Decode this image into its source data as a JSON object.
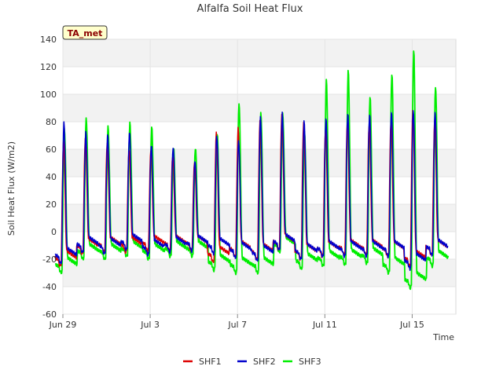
{
  "chart_data": {
    "type": "line",
    "title": "Alfalfa Soil Heat Flux",
    "xlabel": "Time",
    "ylabel": "Soil Heat Flux (W/m2)",
    "badge": "TA_met",
    "xlim": [
      "2023-06-29",
      "2023-07-17"
    ],
    "ylim": [
      -60,
      140
    ],
    "yticks": [
      -60,
      -40,
      -20,
      0,
      20,
      40,
      60,
      80,
      100,
      120,
      140
    ],
    "xticks": [
      {
        "date": "2023-06-29",
        "label": "Jun 29"
      },
      {
        "date": "2023-07-03",
        "label": "Jul 3"
      },
      {
        "date": "2023-07-07",
        "label": "Jul 7"
      },
      {
        "date": "2023-07-11",
        "label": "Jul 11"
      },
      {
        "date": "2023-07-15",
        "label": "Jul 15"
      }
    ],
    "legend_position": "bottom",
    "grid": true,
    "x": [
      "2023-06-29",
      "2023-06-30",
      "2023-07-01",
      "2023-07-02",
      "2023-07-03",
      "2023-07-04",
      "2023-07-05",
      "2023-07-06",
      "2023-07-07",
      "2023-07-08",
      "2023-07-09",
      "2023-07-10",
      "2023-07-11",
      "2023-07-12",
      "2023-07-13",
      "2023-07-14",
      "2023-07-15",
      "2023-07-16"
    ],
    "series": [
      {
        "name": "SHF1",
        "color": "#dd0000",
        "peak": [
          65,
          68,
          65,
          60,
          60,
          55,
          50,
          72,
          75,
          80,
          85,
          80,
          75,
          80,
          78,
          80,
          88,
          80
        ],
        "min": [
          -25,
          -16,
          -15,
          -15,
          -14,
          -14,
          -14,
          -22,
          -18,
          -20,
          -13,
          -20,
          -18,
          -17,
          -17,
          -18,
          -25,
          -17
        ]
      },
      {
        "name": "SHF2",
        "color": "#0000cc",
        "peak": [
          79,
          72,
          70,
          72,
          63,
          62,
          52,
          70,
          66,
          83,
          86,
          80,
          82,
          86,
          86,
          88,
          89,
          87
        ],
        "min": [
          -23,
          -15,
          -16,
          -13,
          -17,
          -15,
          -14,
          -16,
          -19,
          -21,
          -13,
          -20,
          -18,
          -18,
          -18,
          -18,
          -27,
          -17
        ]
      },
      {
        "name": "SHF3",
        "color": "#00ee00",
        "peak": [
          75,
          82,
          76,
          79,
          76,
          61,
          61,
          72,
          94,
          87,
          86,
          72,
          110,
          117,
          98,
          115,
          133,
          106
        ],
        "min": [
          -30,
          -20,
          -20,
          -18,
          -20,
          -18,
          -18,
          -28,
          -30,
          -30,
          -15,
          -27,
          -25,
          -24,
          -23,
          -30,
          -41,
          -25
        ]
      }
    ]
  }
}
